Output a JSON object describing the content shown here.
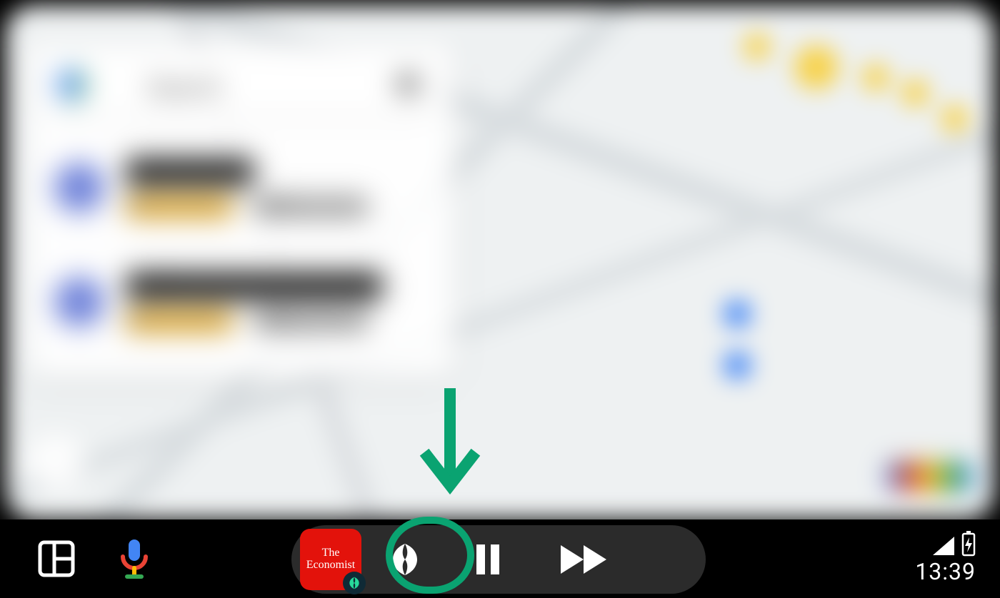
{
  "map_panel": {
    "search_placeholder": "Search",
    "suggestions": [
      {
        "title": "Work",
        "rating": "4.5",
        "distance": "6.2 km"
      },
      {
        "title": "Zurich HB",
        "rating": "4.3",
        "distance": "1.2 km"
      }
    ],
    "logo": "Google"
  },
  "navbar": {
    "launcher_label": "App launcher",
    "assistant_label": "Voice assistant",
    "media": {
      "album_line1": "The",
      "album_line2": "Economist",
      "source_app": "Snipd",
      "play_pause_state": "playing",
      "pause_label": "Pause",
      "next_label": "Next track"
    }
  },
  "status": {
    "signal_label": "Cellular signal",
    "battery_label": "Battery charging",
    "time": "13:39"
  },
  "callout": {
    "target": "media-source-button",
    "arrow_color": "#0aa371"
  }
}
